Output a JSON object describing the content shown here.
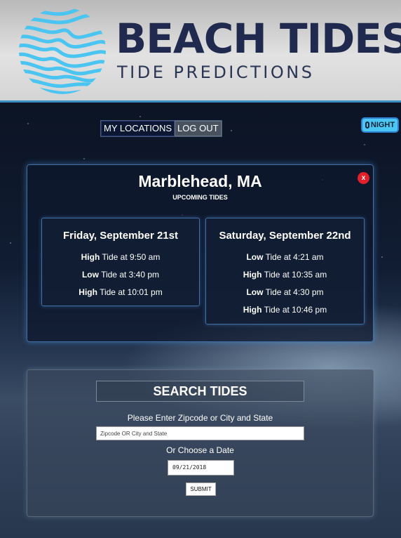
{
  "header": {
    "title": "BEACH TIDES",
    "subtitle": "TIDE PREDICTIONS",
    "logo_icon": "wave-fingerprint-icon",
    "logo_color": "#4ac4f0"
  },
  "nav": {
    "my_locations": "MY LOCATIONS",
    "log_out": "LOG OUT"
  },
  "night_toggle": {
    "label": "NIGHT",
    "knob_label": "0",
    "color": "#4cc6f2"
  },
  "location": {
    "name": "Marblehead, MA",
    "subtitle": "UPCOMING TIDES",
    "close_label": "x",
    "days": [
      {
        "heading": "Friday, September 21st",
        "tides": [
          {
            "type": "High",
            "text": " Tide at 9:50 am"
          },
          {
            "type": "Low",
            "text": " Tide at 3:40 pm"
          },
          {
            "type": "High",
            "text": " Tide at 10:01 pm"
          }
        ]
      },
      {
        "heading": "Saturday, September 22nd",
        "tides": [
          {
            "type": "Low",
            "text": " Tide at 4:21 am"
          },
          {
            "type": "High",
            "text": " Tide at 10:35 am"
          },
          {
            "type": "Low",
            "text": " Tide at 4:30 pm"
          },
          {
            "type": "High",
            "text": " Tide at 10:46 pm"
          }
        ]
      }
    ]
  },
  "search": {
    "title": "SEARCH TIDES",
    "zip_label": "Please Enter Zipcode or City and State",
    "zip_placeholder": "Zipcode OR City and State",
    "date_label": "Or Choose a Date",
    "date_value": "09/21/2018",
    "submit_label": "SUBMIT"
  },
  "colors": {
    "accent_border": "#3f6fa6",
    "brand_text": "#1f2a4e",
    "close_red": "#e0202a"
  }
}
